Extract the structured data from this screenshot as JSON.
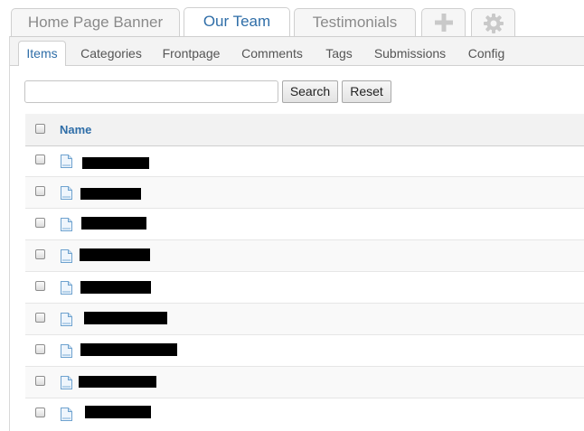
{
  "top_tabs": [
    {
      "label": "Home Page Banner",
      "active": false
    },
    {
      "label": "Our Team",
      "active": true
    },
    {
      "label": "Testimonials",
      "active": false
    }
  ],
  "top_tab_icons": [
    "plus-icon",
    "gear-icon"
  ],
  "sub_tabs": [
    {
      "label": "Items",
      "active": true
    },
    {
      "label": "Categories",
      "active": false
    },
    {
      "label": "Frontpage",
      "active": false
    },
    {
      "label": "Comments",
      "active": false
    },
    {
      "label": "Tags",
      "active": false
    },
    {
      "label": "Submissions",
      "active": false
    },
    {
      "label": "Config",
      "active": false
    }
  ],
  "search": {
    "value": "",
    "placeholder": ""
  },
  "buttons": {
    "search": "Search",
    "reset": "Reset"
  },
  "table": {
    "header": "Name",
    "row_icon": "document-icon",
    "rows_note": "Item names are redacted (shown as black bars)",
    "row_count": 9
  },
  "colors": {
    "accent": "#2f6ea8",
    "tab_text": "#8a8a8a",
    "redaction": "#000000"
  }
}
